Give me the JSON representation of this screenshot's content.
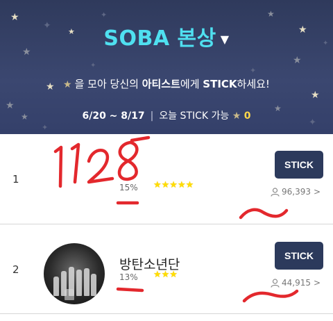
{
  "header": {
    "title": "SOBA 본상",
    "caret_icon": "caret-down-icon",
    "subtitle_pre": "을 모아 당신의 ",
    "subtitle_bold1": "아티스트",
    "subtitle_mid": "에게 ",
    "subtitle_bold2": "STICK",
    "subtitle_post": "하세요!",
    "period": "6/20 ~ 8/17",
    "separator": "|",
    "today_label": "오늘 STICK 가능",
    "today_count": "0"
  },
  "rows": [
    {
      "rank": "1",
      "name": "",
      "percent": "15%",
      "stars": "★★★★★",
      "button": "STICK",
      "votes": "96,393",
      "chevron": ">"
    },
    {
      "rank": "2",
      "name": "방탄소년단",
      "percent": "13%",
      "stars": "★★★",
      "button": "STICK",
      "votes": "44,915",
      "chevron": ">"
    }
  ],
  "annotation": {
    "handwritten": "1128",
    "color": "#e3282d"
  },
  "colors": {
    "header_bg": "#34406a",
    "title": "#4fe0f0",
    "button_bg": "#2c3a5c",
    "star_gold": "#ffdd00",
    "count_yellow": "#ffd84a"
  }
}
